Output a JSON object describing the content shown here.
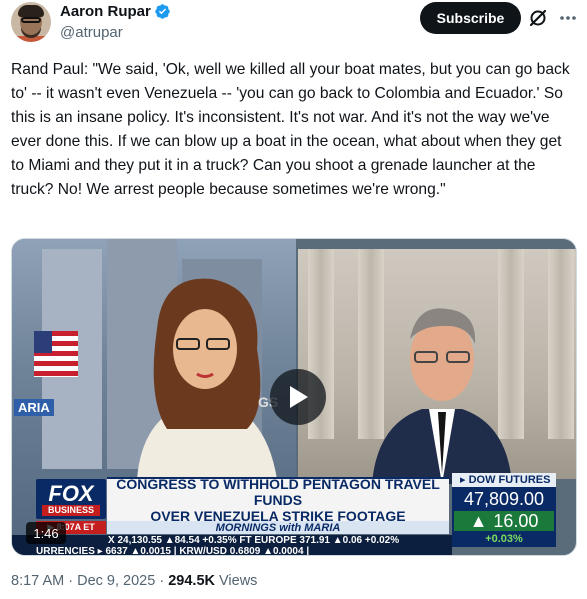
{
  "author": {
    "display_name": "Aaron Rupar",
    "handle": "@atrupar"
  },
  "actions": {
    "subscribe_label": "Subscribe"
  },
  "tweet": {
    "text": "Rand Paul: \"We said, 'Ok, well we killed all your boat mates, but you can go back to' -- it wasn't even Venezuela -- 'you can go back to Colombia and Ecuador.' So this is an insane policy. It's inconsistent. It's not war. And it's not the way we've ever done this. If we can blow up a boat in the ocean, what about when they get to Miami and they put it in a truck? Can you shoot a grenade launcher at the truck? No! We arrest people because sometimes we're wrong.\""
  },
  "video": {
    "duration": "1:46",
    "network": "FOX",
    "network_sub": "BUSINESS",
    "time_chip": "▶ 8:07A ET",
    "headline_line1": "CONGRESS TO WITHHOLD PENTAGON TRAVEL FUNDS",
    "headline_line2": "OVER VENEZUELA STRIKE FOOTAGE",
    "show_name": "MORNINGS with MARIA",
    "dow_label": "▸ DOW FUTURES",
    "dow_value": "47,809.00",
    "dow_change": "16.00",
    "dow_pct": "+0.03%",
    "ticker_row1": "X   24,130.55 ▲84.54 +0.35%  FT EUROPE   371.91 ▲0.06 +0.02%",
    "ticker_row2": "URRENCIES ▸ 6637 ▲0.0015 | KRW/USD 0.6809 ▲0.0004 |",
    "left_screen_text": "ARIA",
    "right_screen_text": "GS"
  },
  "meta": {
    "time": "8:17 AM",
    "separator": "·",
    "date": "Dec 9, 2025",
    "views_count": "294.5K",
    "views_label": "Views"
  },
  "colors": {
    "verified_blue": "#1d9bf0",
    "subscribe_bg": "#0f1419",
    "fox_navy": "#0a2a66",
    "fox_red": "#c41e1e",
    "up_green": "#1b7a3b"
  },
  "icons": [
    "verified-badge-icon",
    "grok-icon",
    "more-icon",
    "play-icon"
  ]
}
